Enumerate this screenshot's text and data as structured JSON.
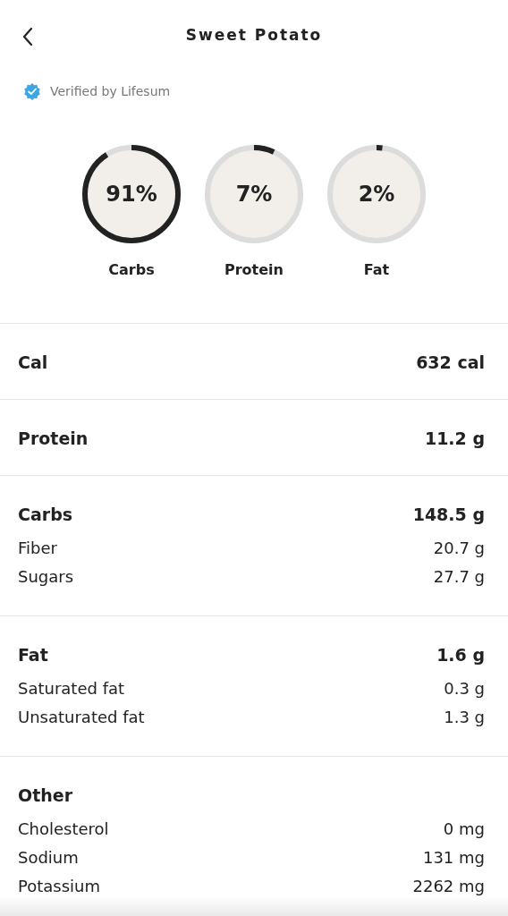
{
  "header": {
    "title": "Sweet Potato"
  },
  "verified": "Verified by Lifesum",
  "macros": [
    {
      "percent": "91%",
      "label": "Carbs",
      "level": 0.91
    },
    {
      "percent": "7%",
      "label": "Protein",
      "level": 0.07
    },
    {
      "percent": "2%",
      "label": "Fat",
      "level": 0.02
    }
  ],
  "sections": [
    {
      "title": "Cal",
      "value": "632 cal"
    },
    {
      "title": "Protein",
      "value": "11.2 g"
    },
    {
      "title": "Carbs",
      "value": "148.5 g",
      "items": [
        {
          "label": "Fiber",
          "value": "20.7 g"
        },
        {
          "label": "Sugars",
          "value": "27.7 g"
        }
      ]
    },
    {
      "title": "Fat",
      "value": "1.6 g",
      "items": [
        {
          "label": "Saturated fat",
          "value": "0.3 g"
        },
        {
          "label": "Unsaturated fat",
          "value": "1.3 g"
        }
      ]
    },
    {
      "title": "Other",
      "items": [
        {
          "label": "Cholesterol",
          "value": "0 mg"
        },
        {
          "label": "Sodium",
          "value": "131 mg"
        },
        {
          "label": "Potassium",
          "value": "2262 mg"
        }
      ]
    }
  ]
}
